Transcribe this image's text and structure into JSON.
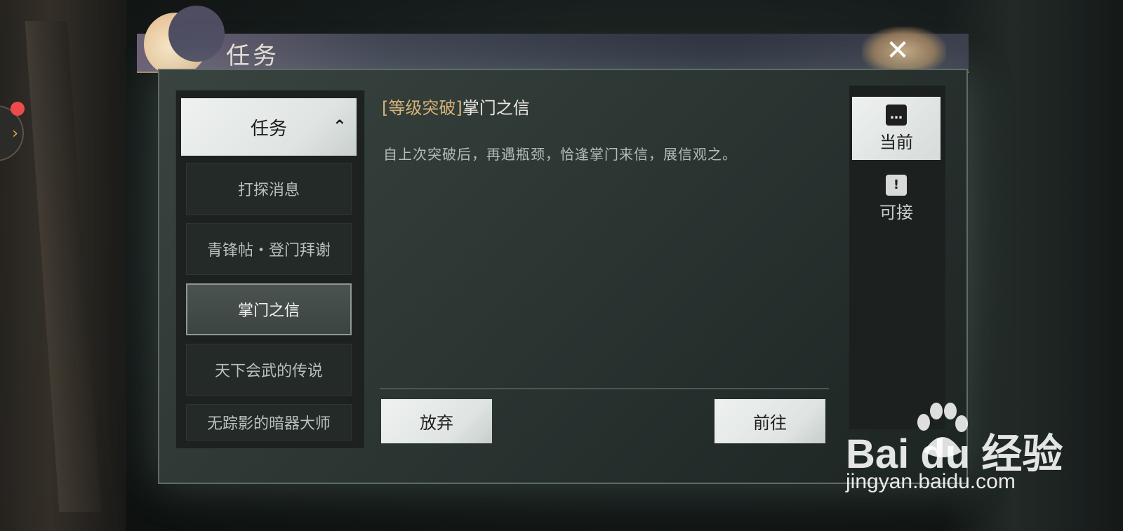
{
  "window": {
    "title": "任务",
    "close_symbol": "✕"
  },
  "side_toggle": {
    "symbol": "›"
  },
  "task_list": {
    "header_label": "任务",
    "header_chevron": "⌃",
    "items": [
      {
        "label": "打探消息",
        "selected": false
      },
      {
        "label": "青锋帖・登门拜谢",
        "selected": false
      },
      {
        "label": "掌门之信",
        "selected": true
      },
      {
        "label": "天下会武的传说",
        "selected": false
      },
      {
        "label": "无踪影的暗器大师",
        "selected": false
      }
    ]
  },
  "task_detail": {
    "tag": "[等级突破]",
    "title": "掌门之信",
    "description": "自上次突破后，再遇瓶颈，恰逢掌门来信，展信观之。"
  },
  "actions": {
    "abandon_label": "放弃",
    "goto_label": "前往"
  },
  "tabs": [
    {
      "label": "当前",
      "icon": "scroll-chat-icon",
      "icon_glyph": "…",
      "active": true
    },
    {
      "label": "可接",
      "icon": "scroll-alert-icon",
      "icon_glyph": "!",
      "active": false
    }
  ],
  "watermark": {
    "logo_text": "Bai du 经验",
    "url": "jingyan.baidu.com"
  },
  "colors": {
    "tag_gold": "#d5b377",
    "notification_red": "#ec4b4b",
    "toggle_gold": "#e6a935"
  }
}
